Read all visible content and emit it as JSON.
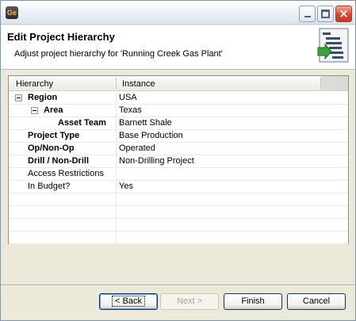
{
  "window": {
    "app_icon_text": "Ge",
    "buttons": {
      "minimize": "minimize",
      "maximize": "maximize",
      "close": "×"
    }
  },
  "header": {
    "title": "Edit Project Hierarchy",
    "subtitle": "Adjust project hierarchy for 'Running Creek Gas Plant'",
    "icon": "hierarchy-wizard-icon"
  },
  "table": {
    "columns": [
      "Hierarchy",
      "Instance"
    ],
    "rows": [
      {
        "name": "Region",
        "value": "USA",
        "bold": true,
        "level": 0,
        "toggle": true
      },
      {
        "name": "Area",
        "value": "Texas",
        "bold": true,
        "level": 1,
        "toggle": true
      },
      {
        "name": "Asset Team",
        "value": "Barnett Shale",
        "bold": true,
        "level": 2,
        "toggle": false
      },
      {
        "name": "Project Type",
        "value": "Base Production",
        "bold": true,
        "level": 0,
        "toggle": false
      },
      {
        "name": "Op/Non-Op",
        "value": "Operated",
        "bold": true,
        "level": 0,
        "toggle": false
      },
      {
        "name": "Drill / Non-Drill",
        "value": "Non-Drilling Project",
        "bold": true,
        "level": 0,
        "toggle": false
      },
      {
        "name": "Access Restrictions",
        "value": "",
        "bold": false,
        "level": 0,
        "toggle": false
      },
      {
        "name": "In Budget?",
        "value": "Yes",
        "bold": false,
        "level": 0,
        "toggle": false
      },
      {
        "name": "",
        "value": "",
        "bold": false,
        "level": 0,
        "toggle": false
      },
      {
        "name": "",
        "value": "",
        "bold": false,
        "level": 0,
        "toggle": false
      },
      {
        "name": "",
        "value": "",
        "bold": false,
        "level": 0,
        "toggle": false
      },
      {
        "name": "",
        "value": "",
        "bold": false,
        "level": 0,
        "toggle": false
      }
    ]
  },
  "footer": {
    "back_label": "< Back",
    "next_label": "Next >",
    "finish_label": "Finish",
    "cancel_label": "Cancel"
  },
  "colors": {
    "accent": "#2e8b2e",
    "title_bar": "#dde4ee",
    "close": "#d9472b"
  }
}
